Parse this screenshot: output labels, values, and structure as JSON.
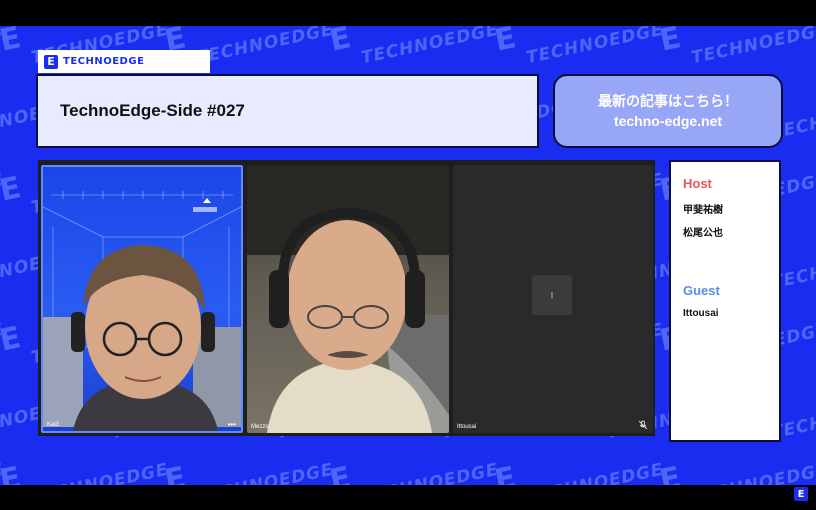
{
  "brand": {
    "logo_text": "TECHNOEDGE",
    "watermark": "TECHNOEDGE",
    "accent_color": "#1a2cf0"
  },
  "title_box": {
    "title": "TechnoEdge-Side #027"
  },
  "link_box": {
    "line1": "最新の記事はこちら！",
    "line2": "techno-edge.net"
  },
  "video_tiles": [
    {
      "name": "Kai3",
      "more_icon": "more-icon"
    },
    {
      "name": "Mezzo"
    },
    {
      "name": "Ittousai",
      "center_text": "I",
      "mic_icon": "mic-off-icon"
    }
  ],
  "side_panel": {
    "host_label": "Host",
    "hosts": [
      "甲斐祐樹",
      "松尾公也"
    ],
    "guest_label": "Guest",
    "guests": [
      "Ittousai"
    ],
    "host_color": "#e8565a",
    "guest_color": "#5b8de6"
  }
}
